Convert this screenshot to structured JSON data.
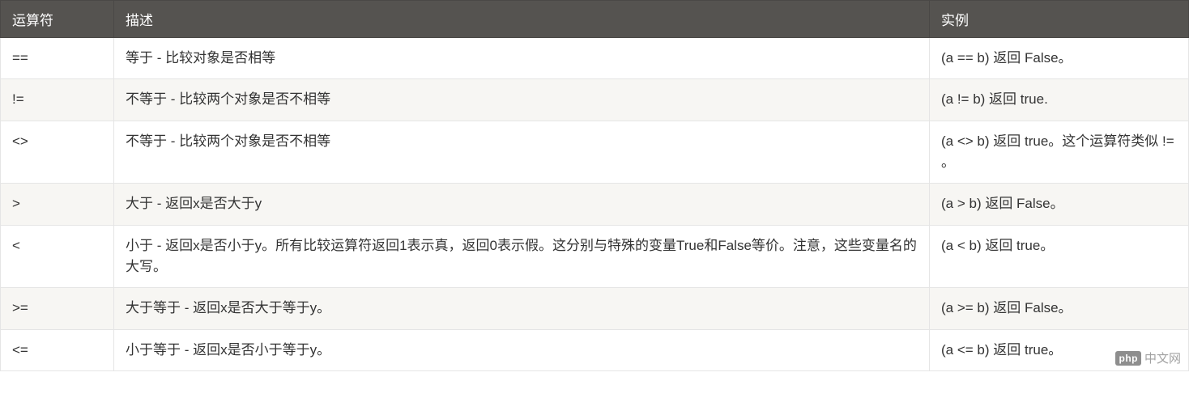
{
  "table": {
    "headers": {
      "operator": "运算符",
      "description": "描述",
      "example": "实例"
    },
    "rows": [
      {
        "operator": "==",
        "description": "等于 - 比较对象是否相等",
        "example": "(a == b) 返回 False。"
      },
      {
        "operator": "!=",
        "description": "不等于 - 比较两个对象是否不相等",
        "example": "(a != b) 返回 true."
      },
      {
        "operator": "<>",
        "description": "不等于 - 比较两个对象是否不相等",
        "example": "(a <> b) 返回 true。这个运算符类似 != 。"
      },
      {
        "operator": ">",
        "description": "大于 - 返回x是否大于y",
        "example": "(a > b) 返回 False。"
      },
      {
        "operator": "<",
        "description": "小于 - 返回x是否小于y。所有比较运算符返回1表示真，返回0表示假。这分别与特殊的变量True和False等价。注意，这些变量名的大写。",
        "example": "(a < b) 返回 true。"
      },
      {
        "operator": ">=",
        "description": "大于等于 - 返回x是否大于等于y。",
        "example": "(a >= b) 返回 False。"
      },
      {
        "operator": "<=",
        "description": "小于等于 - 返回x是否小于等于y。",
        "example": "(a <= b) 返回 true。"
      }
    ]
  },
  "watermark": {
    "logo": "php",
    "text": "中文网"
  }
}
